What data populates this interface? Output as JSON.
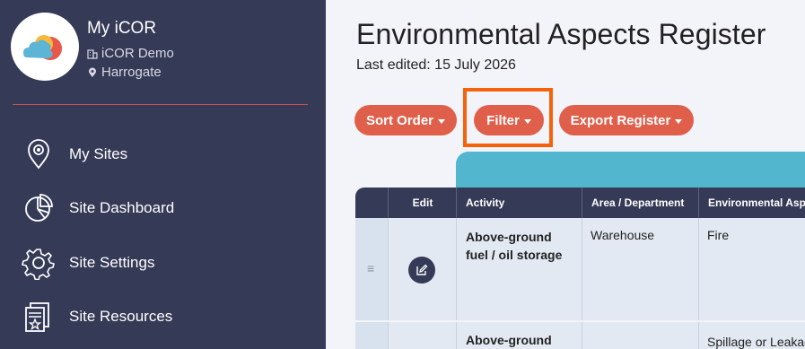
{
  "sidebar": {
    "app_title": "My iCOR",
    "org": "iCOR Demo",
    "location": "Harrogate",
    "items": [
      {
        "label": "My Sites",
        "icon": "location-pin-icon"
      },
      {
        "label": "Site Dashboard",
        "icon": "pie-chart-icon"
      },
      {
        "label": "Site Settings",
        "icon": "gear-icon"
      },
      {
        "label": "Site Resources",
        "icon": "documents-icon"
      }
    ]
  },
  "main": {
    "title": "Environmental Aspects Register",
    "last_edited": "Last edited: 15 July 2026",
    "buttons": {
      "sort": "Sort Order",
      "filter": "Filter",
      "export": "Export Register"
    }
  },
  "table": {
    "columns": [
      "Edit",
      "Activity",
      "Area / Department",
      "Environmental Aspect"
    ],
    "rows": [
      {
        "activity_line1": "Above-ground",
        "activity_line2": "fuel / oil storage",
        "area": "Warehouse",
        "aspect": "Fire"
      },
      {
        "activity_line1": "Above-ground",
        "activity_line2": "",
        "area": "",
        "aspect": "Spillage or Leakage"
      }
    ]
  },
  "colors": {
    "sidebar_bg": "#353a56",
    "accent_button": "#e05f4b",
    "highlight": "#f5620a",
    "teal": "#52b6cf"
  }
}
